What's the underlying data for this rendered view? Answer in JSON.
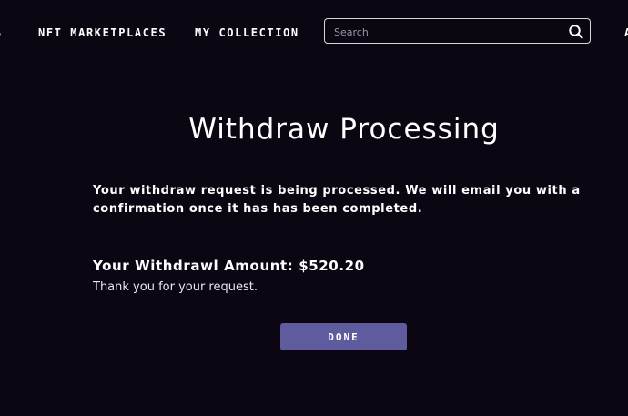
{
  "nav": {
    "clipped_left_label": "S",
    "marketplaces_label": "NFT MARKETPLACES",
    "collection_label": "MY COLLECTION",
    "clipped_right_label": "A"
  },
  "search": {
    "placeholder": "Search",
    "icon": "search-icon"
  },
  "dialog": {
    "title": "Withdraw Processing",
    "message": "Your withdraw request is being processed. We will email you with a confirmation once it has has been completed.",
    "amount_label": "Your Withdrawl Amount: $520.20",
    "thanks": "Thank you for your request.",
    "done_label": "DONE"
  },
  "colors": {
    "background": "#0c0613",
    "button": "#5e5b9e",
    "text": "#ffffff"
  }
}
